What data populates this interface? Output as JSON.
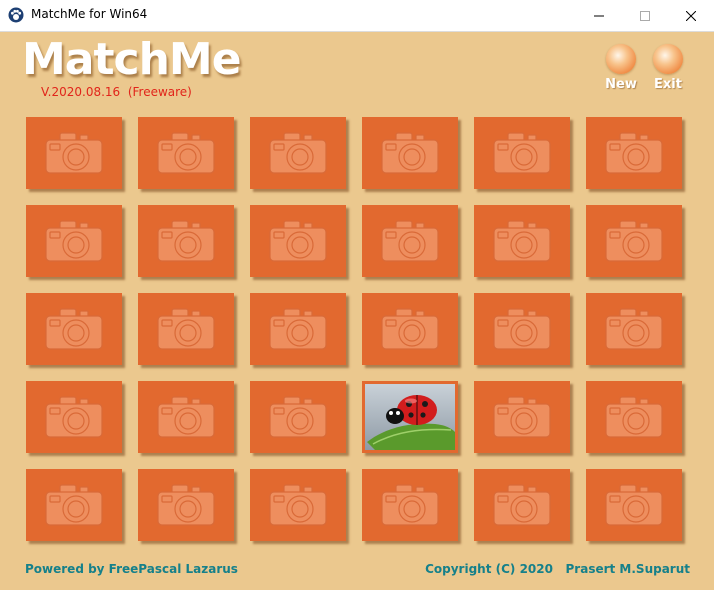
{
  "window": {
    "title": "MatchMe for Win64",
    "app_icon": "paw-icon",
    "controls": [
      "minimize-icon",
      "maximize-icon",
      "close-icon"
    ]
  },
  "header": {
    "logo": "MatchMe",
    "version": "V.2020.08.16  (Freeware)",
    "new_label": "New",
    "exit_label": "Exit"
  },
  "colors": {
    "background": "#ebc88e",
    "card": "#e2692f",
    "version_text": "#e1251b",
    "footer_text": "#15808a"
  },
  "board": {
    "rows": 5,
    "cols": 6,
    "card_back_icon": "camera-icon",
    "revealed": [
      {
        "row": 4,
        "col": 4,
        "image": "ladybug-on-leaf"
      }
    ]
  },
  "footer": {
    "left": "Powered by FreePascal Lazarus",
    "right": "Copyright (C) 2020   Prasert M.Suparut"
  }
}
